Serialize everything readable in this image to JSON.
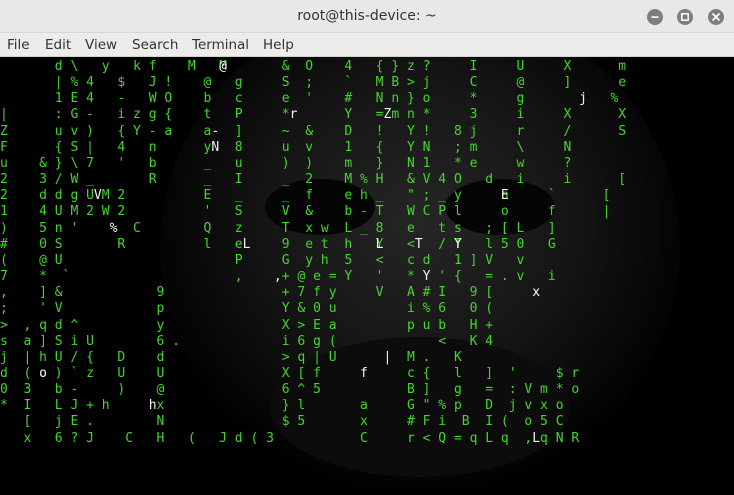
{
  "window": {
    "title": "root@this-device: ~",
    "controls": [
      "minimize-icon",
      "maximize-icon",
      "close-icon"
    ]
  },
  "menu": {
    "items": [
      "File",
      "Edit",
      "View",
      "Search",
      "Terminal",
      "Help"
    ]
  },
  "terminal": {
    "background": "#000000",
    "text_color": "#44d62c",
    "highlight_color": "#f2f2f2",
    "matrix_green_lines": [
      "       d \\   y   k f    M   M       &  O    4   { } z ?     I     U     X      m",
      "       | % 4   $   J !    @   g     S  ;    `   M B > j     C     @     ]      e",
      "       1 E 4   -   W O    b   c     e  '    #   N n } o     *     g           %",
      "|      : G -   i z g {    t   P     *       Y   = m n *     3     i     X      X",
      "Z      u v )   { Y - a    a   ]     ~  &    D   !   Y !   8 j     r     /      S",
      "F      { S |   4   n      y   8     u  v    1   {   Y N   ; m     \\     N",
      "u    & } \\ 7   '   b      _   u     )  )    m   }   N 1   * e     w     ?",
      "2    3 / W _       R      _   I     _  2    M % H   & V 4 O   d   i     i      [",
      "2    d d g U M 2          E   _     _  f    e h _   \" ; _ y     n     `      [",
      "1    4 U M 2 W 2          '   S     V  &    b - T   W C P l     o     f      |",
      ")    5 n '       C        Q   z     T  x w  L _ 8   e   t s   ; [ L   ]",
      "#    0 S       R          l   e     9  e t  h   Y   <   / T   l 5 0   G",
      "(    @ U                      P     G  y h  5   <   c d   1 ] V   v",
      "7    *  `                     ,     + @ e = Y   '   *   ' {   = . v   i",
      ",    ] &            9               + 7 f y     V   A # I   9 [     x",
      ";    ' V            p               Y & 0 u         i % 6   0 (",
      ">  , q d ^          y               X > E a         p u b   H +",
      "s  a ] S i U        6 .             i 6 g (             <   K 4",
      "j  | h U / {   D    d               > q | U         M .   K",
      "d  ( o ) ` z   U    U               X [ f           c {   l   ]  '     $ r",
      "0  3   b -     )    @               6 ^ 5           B ]   g   =  : V m * o",
      "*  I   L J + h      x               } l       a     G \" % p   D  j v x o",
      "   [   j E .        N               $ 5       x     # F i  B  I (  o 5 C",
      "   x   6 ? J    C   H   (   J d ( 3           C     r < Q = q L q  , q N R"
    ],
    "matrix_white_lines": [
      "                            @",
      "",
      "                                                                          j",
      "                                     r           Z",
      "                           -",
      "                           N",
      "",
      "",
      "            V                                                   E",
      "",
      "              %",
      "                               L                L    T    Y",
      "",
      "                                   ,                  Y",
      "                                                                    x",
      "",
      "",
      "",
      "                                                 |",
      "     o                                        f",
      "",
      "                   h",
      "",
      "                                                                    L"
    ]
  }
}
